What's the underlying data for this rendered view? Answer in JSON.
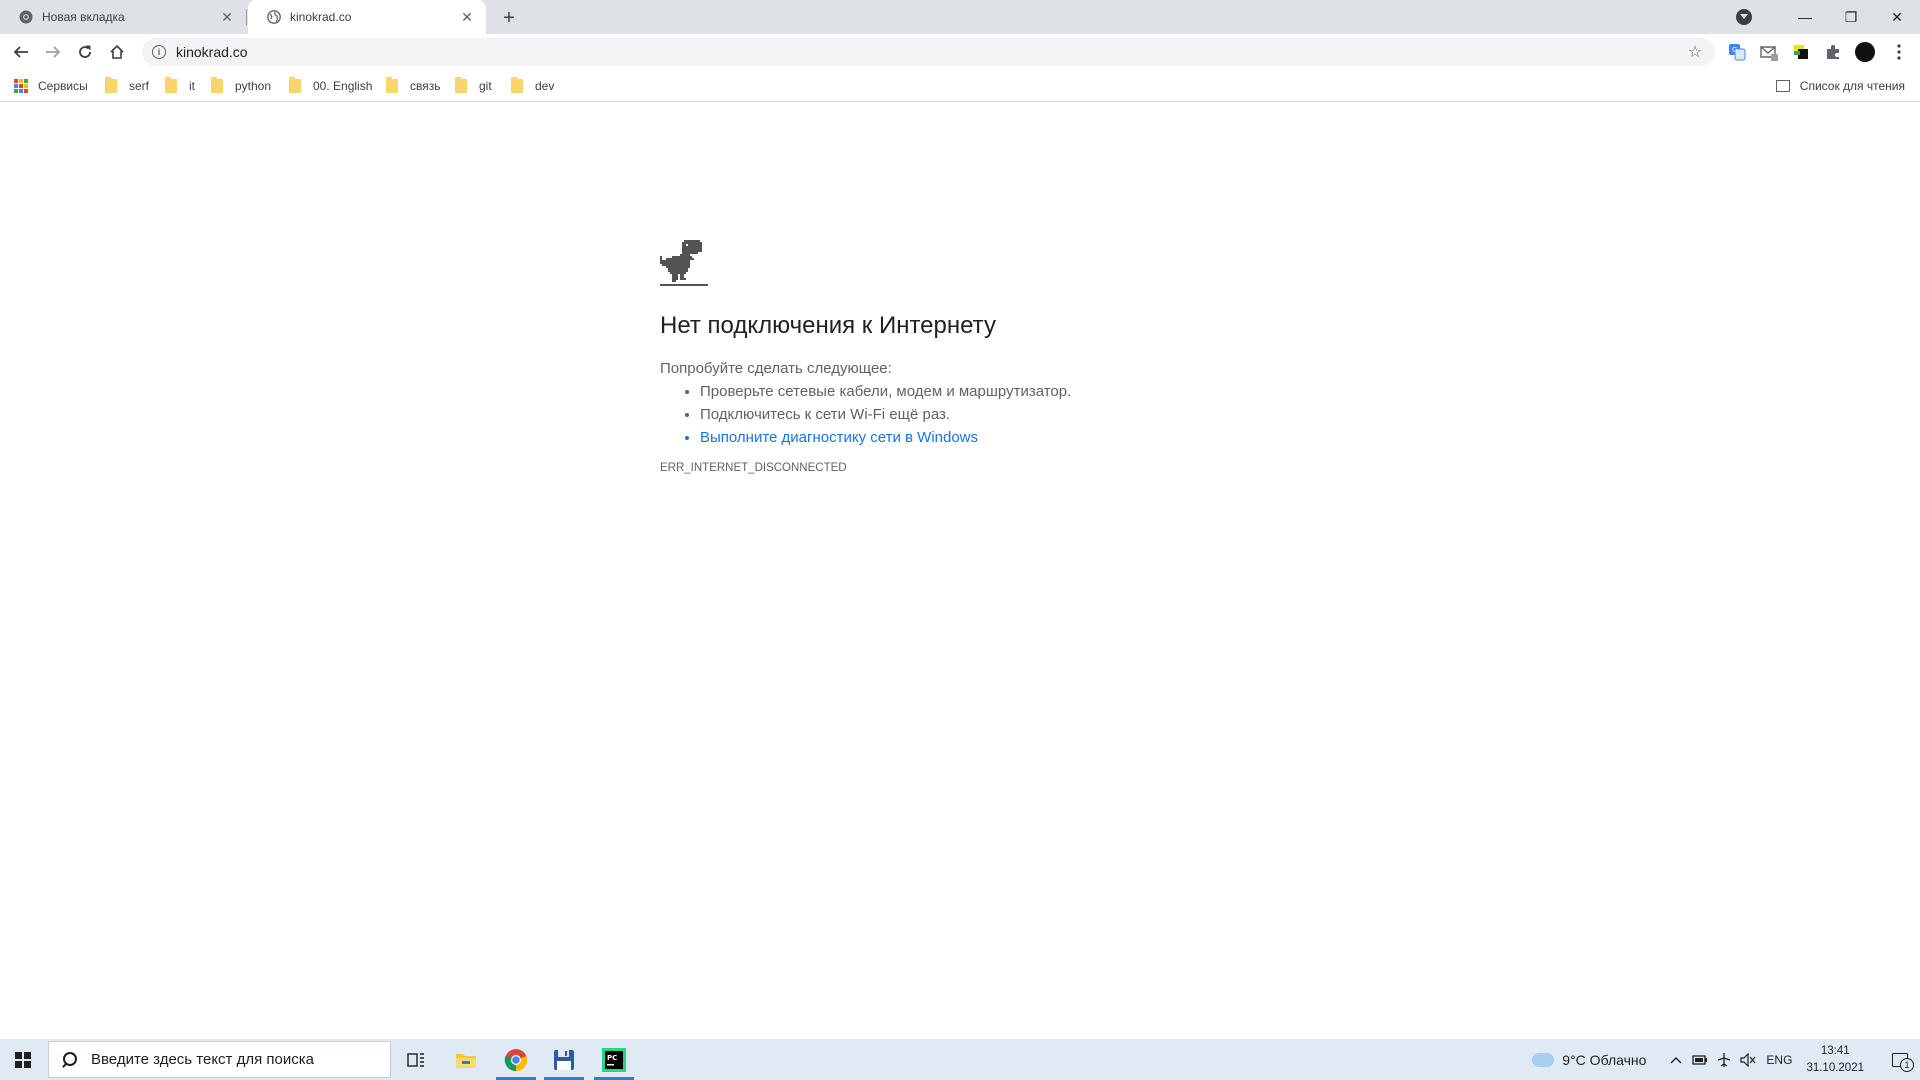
{
  "tabs": [
    {
      "title": "Новая вкладка",
      "active": false
    },
    {
      "title": "kinokrad.co",
      "active": true
    }
  ],
  "window_controls": {
    "minimize": "—",
    "restore": "❐",
    "close": "✕"
  },
  "omnibox": {
    "url": "kinokrad.co"
  },
  "bookmarks": {
    "apps_label": "Сервисы",
    "items": [
      {
        "label": "serf"
      },
      {
        "label": "it"
      },
      {
        "label": "python"
      },
      {
        "label": "00. English"
      },
      {
        "label": "связь"
      },
      {
        "label": "git"
      },
      {
        "label": "dev"
      }
    ],
    "reading_list": "Список для чтения"
  },
  "error_page": {
    "heading": "Нет подключения к Интернету",
    "intro": "Попробуйте сделать следующее:",
    "suggestions": [
      "Проверьте сетевые кабели, модем и маршрутизатор.",
      "Подключитесь к сети Wi-Fi ещё раз.",
      "Выполните диагностику сети в Windows"
    ],
    "error_code": "ERR_INTERNET_DISCONNECTED"
  },
  "taskbar": {
    "search_placeholder": "Введите здесь текст для поиска",
    "weather": "9°C  Облачно",
    "language": "ENG",
    "time": "13:41",
    "date": "31.10.2021",
    "notification_count": "1"
  },
  "colors": {
    "tabstrip": "#dee1e6",
    "link": "#1a73e8",
    "taskbar": "#dfeaf5",
    "folder": "#f9d66b"
  }
}
